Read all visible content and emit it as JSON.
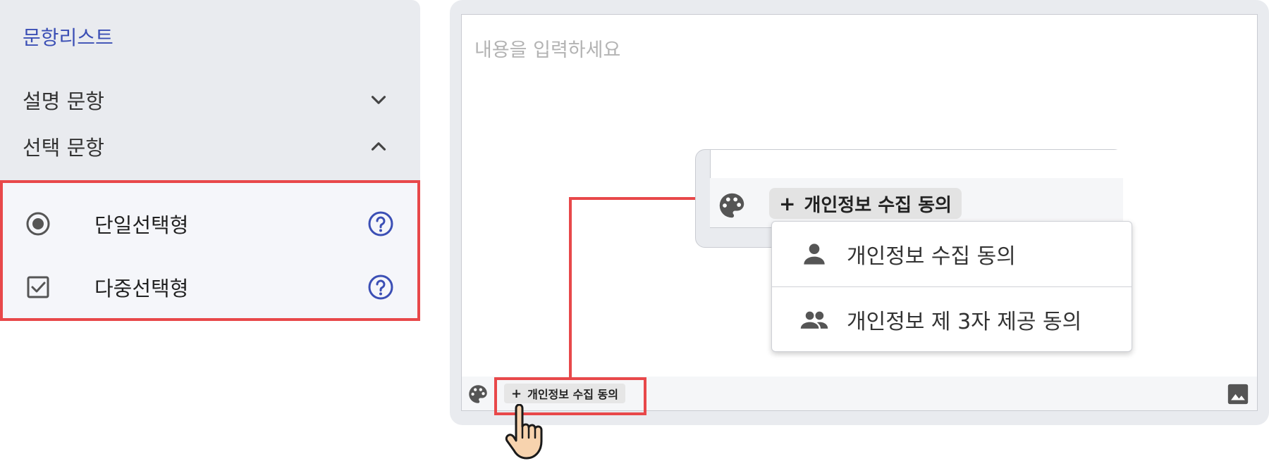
{
  "sidebar": {
    "title": "문항리스트",
    "sections": [
      {
        "label": "설명 문항",
        "state": "collapsed",
        "icon": "chevron-down-icon"
      },
      {
        "label": "선택 문항",
        "state": "expanded",
        "icon": "chevron-up-icon"
      }
    ],
    "types": [
      {
        "label": "단일선택형",
        "icon": "radio-icon",
        "help_icon": "help-icon"
      },
      {
        "label": "다중선택형",
        "icon": "checkbox-icon",
        "help_icon": "help-icon"
      }
    ]
  },
  "editor": {
    "placeholder": "내용을 입력하세요",
    "toolbar": {
      "palette_icon": "palette-icon",
      "chip_plus": "+",
      "chip_label": "개인정보 수집 동의",
      "image_icon": "image-icon"
    }
  },
  "zoom": {
    "chip_plus": "+",
    "chip_label": "개인정보 수집 동의",
    "menu": [
      {
        "label": "개인정보 수집 동의",
        "icon": "person-icon"
      },
      {
        "label": "개인정보 제 3자 제공 동의",
        "icon": "people-icon"
      }
    ]
  },
  "colors": {
    "accent": "#3b4fb5",
    "highlight": "#e8484a",
    "panel_bg": "#e9ebef",
    "icon_gray": "#555555"
  }
}
